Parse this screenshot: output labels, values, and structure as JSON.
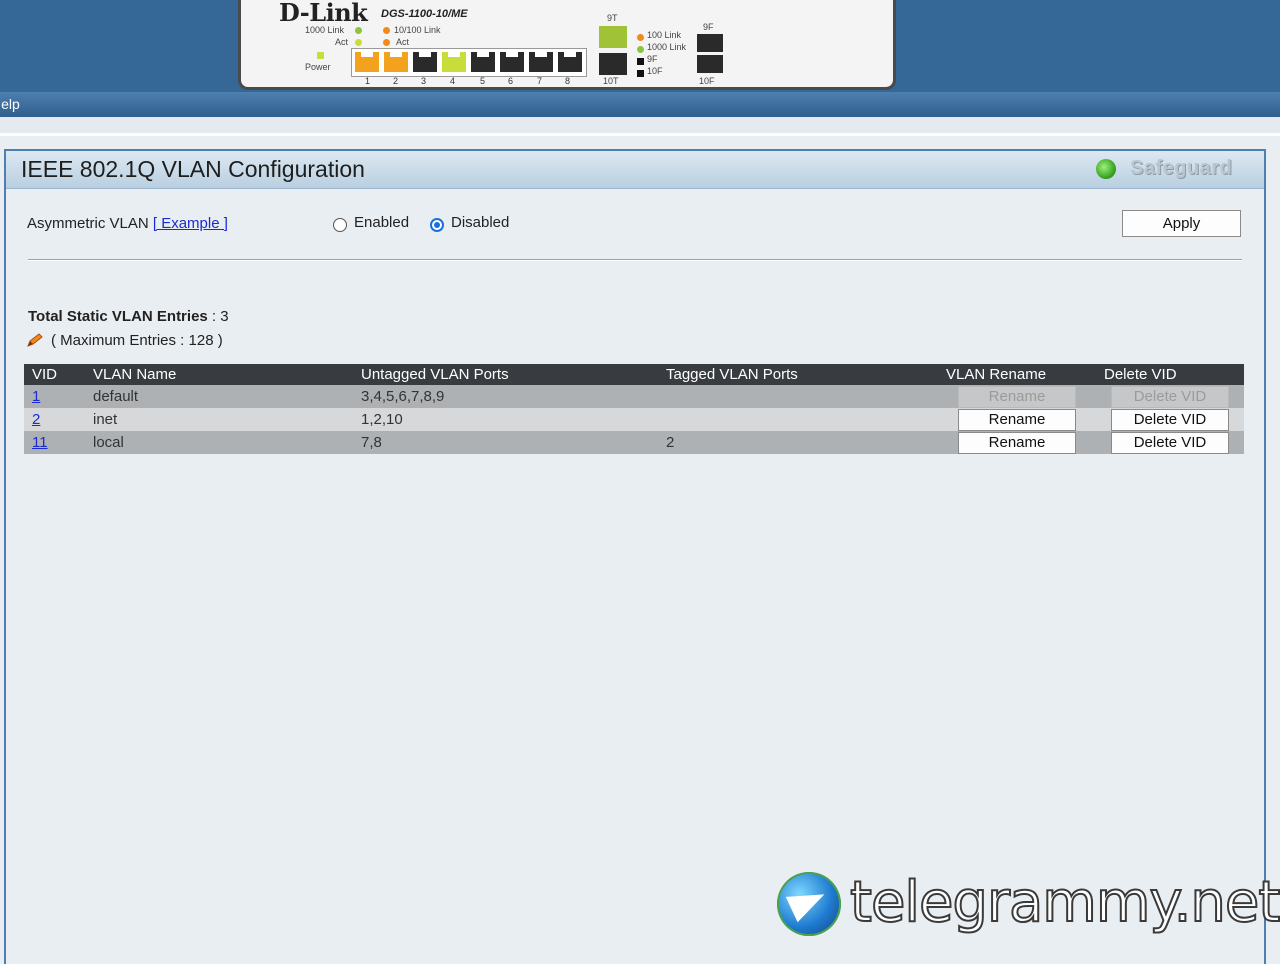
{
  "device": {
    "brand": "D-Link",
    "model": "DGS-1100-10/ME",
    "legend": {
      "link1000": "1000 Link",
      "act": "Act",
      "link10_100": "10/100 Link",
      "act2": "Act",
      "power": "Power",
      "sfp_100": "100 Link",
      "sfp_1000": "1000 Link",
      "sfp_9f": "9F",
      "sfp_10f": "10F"
    },
    "port_numbers": [
      "1",
      "2",
      "3",
      "4",
      "5",
      "6",
      "7",
      "8"
    ],
    "combo_labels": {
      "top_t": "9T",
      "bottom_t": "10T",
      "top_f": "9F",
      "bottom_f": "10F"
    }
  },
  "menubar": {
    "label": "Help"
  },
  "panel": {
    "title": "IEEE 802.1Q VLAN Configuration",
    "safeguard": "Safeguard",
    "asymmetric": {
      "label": "Asymmetric VLAN",
      "example_link": "[ Example ]",
      "enabled_label": "Enabled",
      "disabled_label": "Disabled",
      "selected": "Disabled",
      "apply_label": "Apply"
    },
    "total_label": "Total Static VLAN Entries",
    "total_value": " : 3",
    "max_entries": "( Maximum Entries : 128 )"
  },
  "table": {
    "headers": [
      "VID",
      "VLAN Name",
      "Untagged VLAN Ports",
      "Tagged VLAN Ports",
      "VLAN Rename",
      "Delete VID"
    ],
    "rows": [
      {
        "vid": "1",
        "name": "default",
        "untagged": "3,4,5,6,7,8,9",
        "tagged": "",
        "rename": "Rename",
        "delete": "Delete VID",
        "enabled": false
      },
      {
        "vid": "2",
        "name": "inet",
        "untagged": "1,2,10",
        "tagged": "",
        "rename": "Rename",
        "delete": "Delete VID",
        "enabled": true
      },
      {
        "vid": "11",
        "name": "local",
        "untagged": "7,8",
        "tagged": "2",
        "rename": "Rename",
        "delete": "Delete VID",
        "enabled": true
      }
    ]
  },
  "watermark": {
    "text": "telegrammy.net",
    "icon": "telegram-globe-icon"
  },
  "colors": {
    "header_bg": "#356797",
    "table_header": "#383c40",
    "link": "#1a2bd1"
  }
}
